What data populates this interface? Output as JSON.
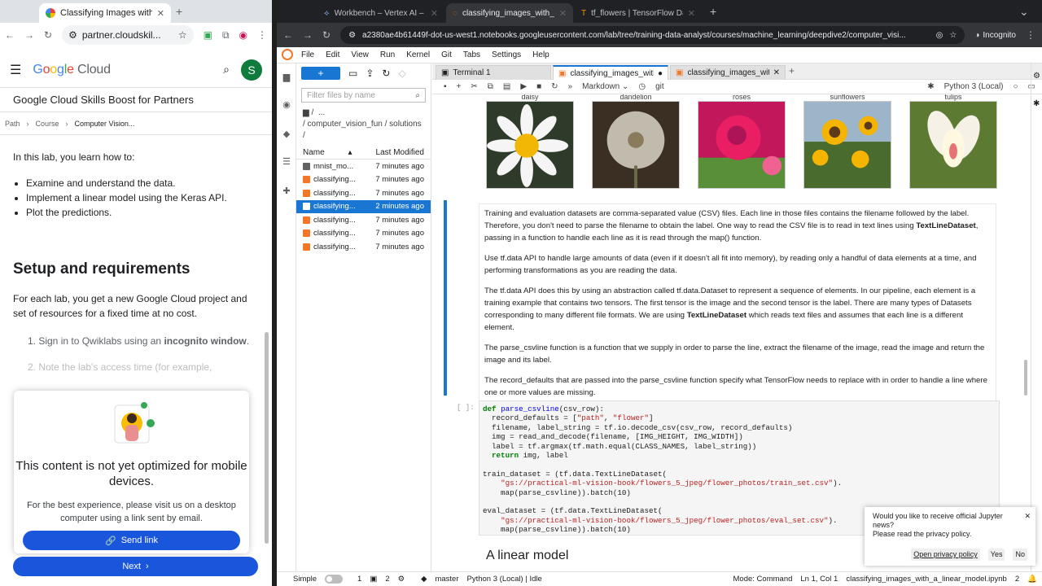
{
  "left": {
    "tab_title": "Classifying Images with a Line",
    "url": "partner.cloudskil...",
    "brand": "Google Cloud",
    "avatar_letter": "S",
    "program": "Google Cloud Skills Boost for Partners",
    "crumbs": [
      "Path",
      "Course",
      "Computer Vision..."
    ],
    "intro": "In this lab, you learn how to:",
    "bullets": [
      "Examine and understand the data.",
      "Implement a linear model using the Keras API.",
      "Plot the predictions."
    ],
    "setup_heading": "Setup and requirements",
    "setup_text": "For each lab, you get a new Google Cloud project and set of resources for a fixed time at no cost.",
    "step1_pre": "1. Sign in to Qwiklabs using an ",
    "step1_bold": "incognito window",
    "step1_post": ".",
    "step2": "2. Note the lab's access time (for example,",
    "modal_title": "This content is not yet optimized for mobile devices.",
    "modal_text": "For the best experience, please visit us on a desktop computer using a link sent by email.",
    "send_link": "Send link",
    "next": "Next"
  },
  "right": {
    "tabs": [
      "Workbench – Vertex AI – qwik",
      "classifying_images_with_a_li",
      "tf_flowers | TensorFlow Data"
    ],
    "url": "a2380ae4b61449f-dot-us-west1.notebooks.googleusercontent.com/lab/tree/training-data-analyst/courses/machine_learning/deepdive2/computer_visi...",
    "incognito": "Incognito",
    "menu": [
      "File",
      "Edit",
      "View",
      "Run",
      "Kernel",
      "Git",
      "Tabs",
      "Settings",
      "Help"
    ],
    "filter_placeholder": "Filter files by name",
    "path_root": "/",
    "path_more": "...",
    "path_line": "/ computer_vision_fun / solutions /",
    "col_name": "Name",
    "col_modified": "Last Modified",
    "files": [
      {
        "name": "mnist_mo...",
        "modified": "7 minutes ago",
        "kind": "folder"
      },
      {
        "name": "classifying...",
        "modified": "7 minutes ago",
        "kind": "nb"
      },
      {
        "name": "classifying...",
        "modified": "7 minutes ago",
        "kind": "nb"
      },
      {
        "name": "classifying...",
        "modified": "2 minutes ago",
        "kind": "nb",
        "selected": true
      },
      {
        "name": "classifying...",
        "modified": "7 minutes ago",
        "kind": "nb"
      },
      {
        "name": "classifying...",
        "modified": "7 minutes ago",
        "kind": "nb"
      },
      {
        "name": "classifying...",
        "modified": "7 minutes ago",
        "kind": "nb"
      }
    ],
    "nb_tabs": [
      "Terminal 1",
      "classifying_images_with_a_",
      "classifying_images_with_a_"
    ],
    "cell_type": "Markdown",
    "kernel": "Python 3 (Local)",
    "flower_captions": [
      "daisy",
      "dandelion",
      "roses",
      "sunflowers",
      "tulips"
    ],
    "md": {
      "p1a": "Training and evaluation datasets are comma-separated value (CSV) files. Each line in those files contains the filename followed by the label. Therefore, you don't need to parse the filename to obtain the label. One way to read the CSV file is to read in text lines using ",
      "p1b": "TextLineDataset",
      "p1c": ", passing in a function to handle each line as it is read through the map() function.",
      "p2": "Use tf.data API to handle large amounts of data (even if it doesn't all fit into memory), by reading only a handful of data elements at a time, and performing transformations as you are reading the data.",
      "p3a": "The tf.data API does this by using an abstraction called tf.data.Dataset to represent a sequence of elements. In our pipeline, each element is a training example that contains two tensors. The first tensor is the image and the second tensor is the label. There are many types of Datasets corresponding to many different file formats. We are using ",
      "p3b": "TextLineDataset",
      "p3c": " which reads text files and assumes that each line is a different element.",
      "p4": "The parse_csvline function is a function that we supply in order to parse the line, extract the filename of the image, read the image and return the image and its label.",
      "p5": "The record_defaults that are passed into the parse_csvline function specify what TensorFlow needs to replace with in order to handle a line where one or more values are missing."
    },
    "prompt": "[ ]:",
    "heading": "A linear model",
    "notif_q": "Would you like to receive official Jupyter news?",
    "notif_p": "Please read the privacy policy.",
    "notif_btns": [
      "Open privacy policy",
      "Yes",
      "No"
    ],
    "status": {
      "mode_label": "Simple",
      "num1": "1",
      "num2": "2",
      "branch": "master",
      "kernel": "Python 3 (Local) | Idle",
      "mode": "Mode: Command",
      "pos": "Ln 1, Col 1",
      "file": "classifying_images_with_a_linear_model.ipynb",
      "count": "2"
    }
  }
}
